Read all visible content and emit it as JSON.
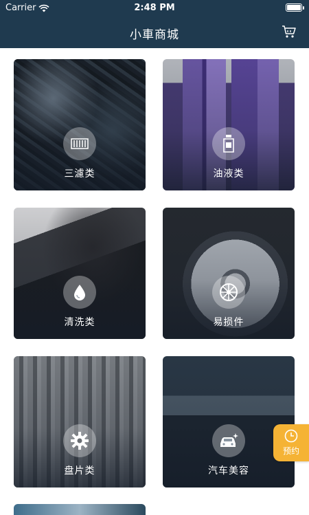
{
  "status_bar": {
    "carrier": "Carrier",
    "time": "2:48 PM"
  },
  "header": {
    "title": "小車商城"
  },
  "categories": [
    {
      "label": "三濾类",
      "icon": "filter-icon"
    },
    {
      "label": "油液类",
      "icon": "oil-bottle-icon"
    },
    {
      "label": "清洗类",
      "icon": "water-drop-icon"
    },
    {
      "label": "易损件",
      "icon": "wheel-icon"
    },
    {
      "label": "盘片类",
      "icon": "gear-icon"
    },
    {
      "label": "汽车美容",
      "icon": "car-shine-icon"
    }
  ],
  "floating_button": {
    "label": "预约",
    "icon": "clock-icon"
  },
  "colors": {
    "header_bg": "#1f3a4f",
    "booking_bg": "#f5b335"
  }
}
